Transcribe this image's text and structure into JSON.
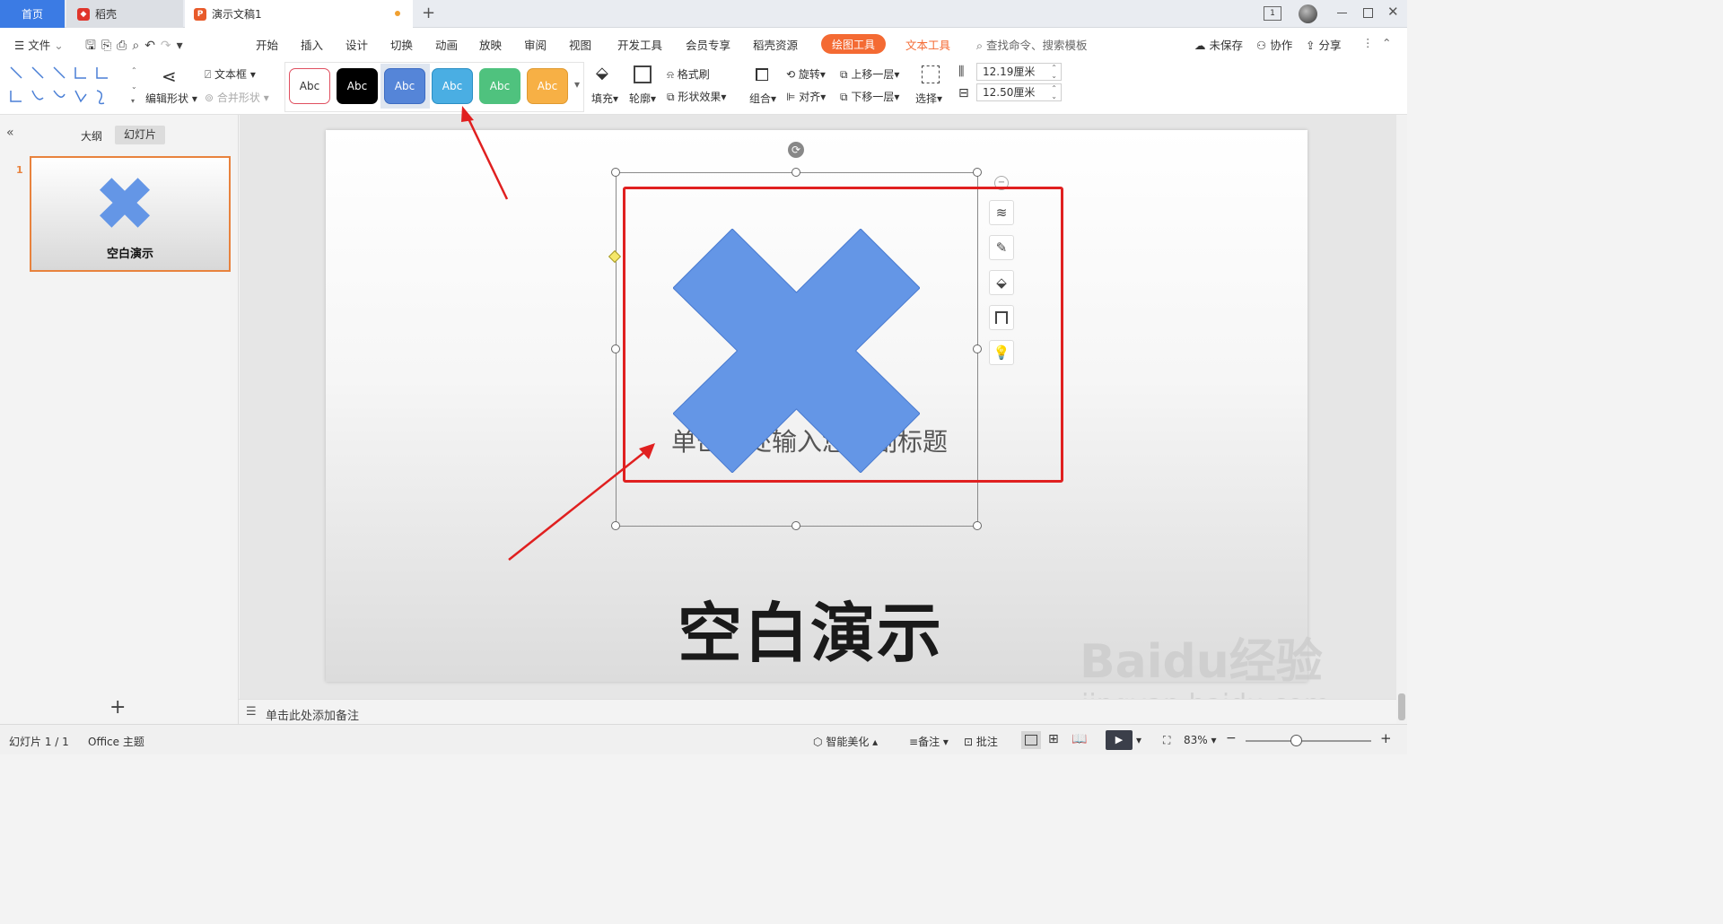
{
  "tabs": {
    "home": "首页",
    "daoke": "稻壳",
    "doc": "演示文稿1",
    "new_tab": "+"
  },
  "menu": {
    "file": "文件",
    "items": [
      "开始",
      "插入",
      "设计",
      "切换",
      "动画",
      "放映",
      "审阅",
      "视图",
      "开发工具",
      "会员专享",
      "稻壳资源"
    ],
    "drawing_tools": "绘图工具",
    "text_tools": "文本工具",
    "search": "查找命令、搜索模板",
    "unsaved": "未保存",
    "collab": "协作",
    "share": "分享"
  },
  "ribbon": {
    "edit_shape": "编辑形状",
    "textbox": "文本框",
    "merge_shape": "合并形状",
    "style_label": "Abc",
    "fill": "填充",
    "outline": "轮廓",
    "format_brush": "格式刷",
    "shape_effect": "形状效果",
    "group": "组合",
    "rotate": "旋转",
    "align": "对齐",
    "bring_forward": "上移一层",
    "send_backward": "下移一层",
    "select": "选择",
    "height": "12.19厘米",
    "width": "12.50厘米"
  },
  "panel": {
    "outline_tab": "大纲",
    "slides_tab": "幻灯片",
    "slide_number": "1",
    "thumb_title": "空白演示",
    "add": "+"
  },
  "slide": {
    "subtitle": "单击此处输入您的副标题",
    "title": "空白演示",
    "watermark_main": "Baidu经验",
    "watermark_sub": "jingyan.baidu.com"
  },
  "notes": {
    "placeholder": "单击此处添加备注"
  },
  "status": {
    "slide_count": "幻灯片 1 / 1",
    "theme": "Office 主题",
    "smart_beautify": "智能美化",
    "notes": "备注",
    "comment": "批注",
    "zoom": "83%"
  },
  "colors": {
    "accent_blue": "#3b7be4",
    "drawing_tools_orange": "#f46a33",
    "shape_blue": "#6496e6",
    "selection_red": "#e02020",
    "style_colors": [
      "#ffffff",
      "#000000",
      "#5585d8",
      "#4aaee3",
      "#4fc27e",
      "#f7b045"
    ]
  }
}
